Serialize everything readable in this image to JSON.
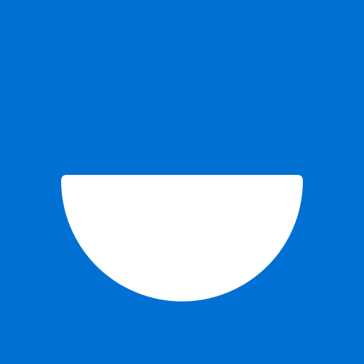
{
  "icon": {
    "name": "bowl-smile-icon",
    "background_color": "#0071d3",
    "shape_color": "#ffffff"
  }
}
